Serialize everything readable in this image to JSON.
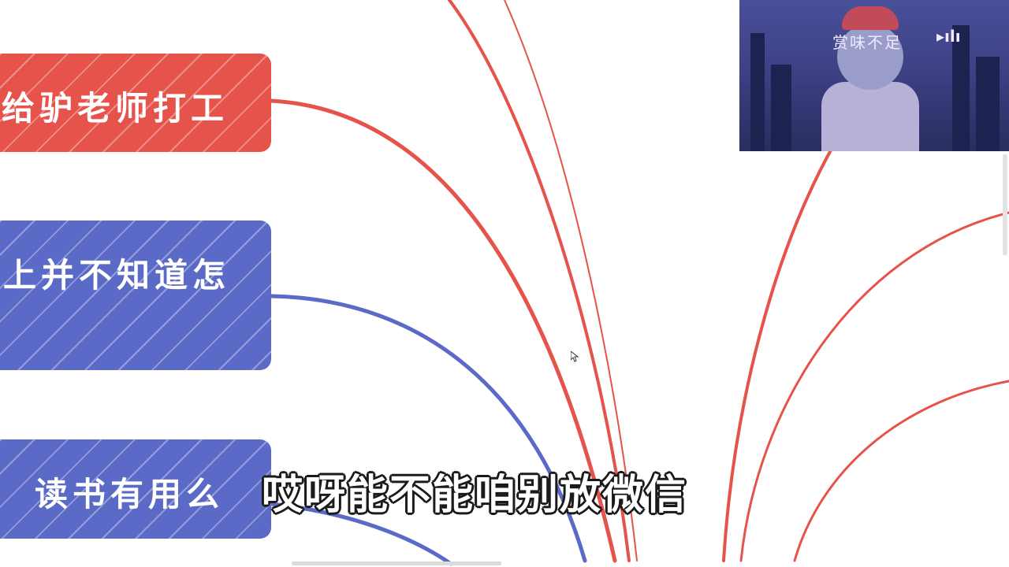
{
  "nodes": {
    "red": {
      "label": "给驴老师打工"
    },
    "blue1": {
      "label": "上并不知道怎"
    },
    "blue2": {
      "label": "读书有用么"
    }
  },
  "subtitle": "哎呀能不能咱别放微信",
  "video_overlay": {
    "caption": "赏味不足"
  },
  "colors": {
    "red": "#e5534b",
    "blue": "#5b6ac6"
  }
}
